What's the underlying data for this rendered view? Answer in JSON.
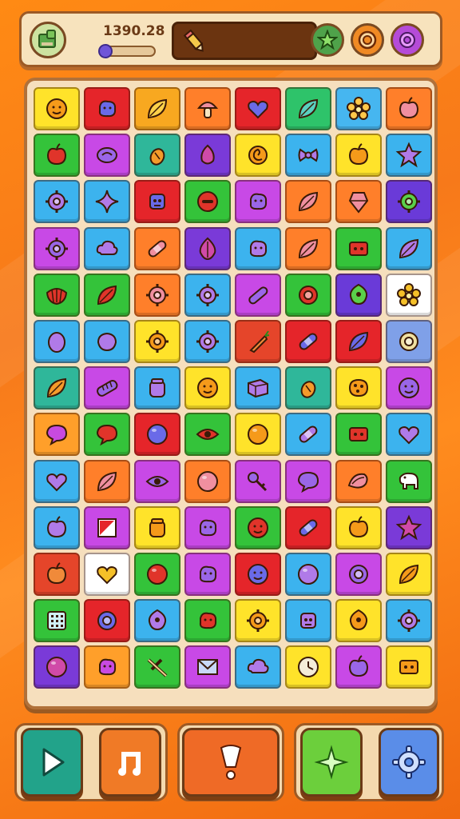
{
  "hud": {
    "score": "1390.28",
    "progress_fraction": 0.12,
    "slot_item": "pencil-icon",
    "buttons": [
      "star-icon",
      "target-icon",
      "gear-icon"
    ],
    "button_colors": [
      "#4fa24a",
      "#f08a24",
      "#b54bd8"
    ]
  },
  "board": {
    "rows": 13,
    "cols": 8,
    "tiles": [
      [
        "#ffe32a",
        "#e5252a",
        "#f8a820",
        "#ff7f2a",
        "#e5252a",
        "#2ec36a",
        "#46b6f0",
        "#ff7f2a"
      ],
      [
        "#34c33a",
        "#c849e6",
        "#2fb79a",
        "#7a3ad8",
        "#ffe32a",
        "#3cb3ee",
        "#ffe32a",
        "#3cb3ee"
      ],
      [
        "#3cb3ee",
        "#3cb3ee",
        "#e5252a",
        "#34c33a",
        "#c849e6",
        "#ff7f2a",
        "#ff7f2a",
        "#6a3ad8"
      ],
      [
        "#c849e6",
        "#3cb3ee",
        "#ff7f2a",
        "#7a3ad8",
        "#3cb3ee",
        "#ff7f2a",
        "#34c33a",
        "#3cb3ee"
      ],
      [
        "#34c33a",
        "#34c33a",
        "#ff7f2a",
        "#3cb3ee",
        "#c849e6",
        "#34c33a",
        "#6a3ad8",
        "#ffffff"
      ],
      [
        "#3cb3ee",
        "#3cb3ee",
        "#ffe32a",
        "#3cb3ee",
        "#e5452a",
        "#e5252a",
        "#e5252a",
        "#7fa0e8"
      ],
      [
        "#2fb79a",
        "#c849e6",
        "#3cb3ee",
        "#ffe32a",
        "#3cb3ee",
        "#2fb79a",
        "#ffe32a",
        "#c849e6"
      ],
      [
        "#ff9f2a",
        "#34c33a",
        "#e5252a",
        "#34c33a",
        "#ffe32a",
        "#3cb3ee",
        "#34c33a",
        "#3cb3ee"
      ],
      [
        "#3cb3ee",
        "#ff7f2a",
        "#c849e6",
        "#ff7f2a",
        "#c849e6",
        "#c849e6",
        "#ff7f2a",
        "#34c33a"
      ],
      [
        "#3cb3ee",
        "#c849e6",
        "#ffe32a",
        "#c849e6",
        "#34c33a",
        "#e5252a",
        "#ffe32a",
        "#7a3ad8"
      ],
      [
        "#e5452a",
        "#ffffff",
        "#34c33a",
        "#c849e6",
        "#e5252a",
        "#3cb3ee",
        "#c849e6",
        "#ffe32a"
      ],
      [
        "#34c33a",
        "#e5252a",
        "#3cb3ee",
        "#34c33a",
        "#ffe32a",
        "#3cb3ee",
        "#ffe32a",
        "#3cb3ee"
      ],
      [
        "#7a3ad8",
        "#ff9f2a",
        "#34c33a",
        "#c849e6",
        "#3cb3ee",
        "#ffe32a",
        "#c849e6",
        "#ffe32a"
      ]
    ],
    "icons": [
      [
        "face",
        "blob",
        "leaf",
        "mushroom",
        "heart",
        "leaf",
        "flower",
        "apple"
      ],
      [
        "apple",
        "nut",
        "acorn",
        "fig",
        "swirl",
        "bow",
        "apple",
        "star"
      ],
      [
        "gear",
        "star4",
        "robot",
        "circle",
        "blob",
        "leaf",
        "crystal",
        "gear"
      ],
      [
        "gear",
        "cloud",
        "bandage",
        "onion",
        "blob",
        "leaf",
        "box",
        "leaf"
      ],
      [
        "shell",
        "leaf",
        "gear",
        "gear",
        "baguette",
        "ring",
        "drop",
        "flower"
      ],
      [
        "egg",
        "lemon",
        "gear",
        "gear",
        "carrot",
        "bandage",
        "leaf",
        "ring"
      ],
      [
        "leaf",
        "bread",
        "jar",
        "face",
        "crate",
        "acorn",
        "cookie",
        "face"
      ],
      [
        "bubble",
        "bubble",
        "ball",
        "eye",
        "ball",
        "bandage",
        "box",
        "heart"
      ],
      [
        "heart",
        "leaf",
        "eye",
        "ball",
        "key",
        "bubble",
        "seed",
        "elephant"
      ],
      [
        "apple",
        "flag",
        "jar",
        "blob",
        "face",
        "bandage",
        "apple",
        "star"
      ],
      [
        "apple",
        "heart",
        "ball",
        "blob",
        "face",
        "ball",
        "ring",
        "leaf"
      ],
      [
        "grid",
        "ring",
        "drop",
        "blob",
        "gear",
        "robot",
        "drop",
        "gear"
      ],
      [
        "ball",
        "blob",
        "pick",
        "envelope",
        "cloud",
        "clock",
        "apple",
        "box"
      ]
    ]
  },
  "bottom": {
    "buttons": [
      {
        "icon": "play-icon",
        "color": "#22a38a"
      },
      {
        "icon": "music-icon",
        "color": "#f07a26"
      },
      {
        "icon": "hint-icon",
        "color": "#ef6a26"
      },
      {
        "icon": "shuffle-icon",
        "color": "#6ccf3c"
      },
      {
        "icon": "settings-icon",
        "color": "#5a8de8"
      }
    ]
  }
}
